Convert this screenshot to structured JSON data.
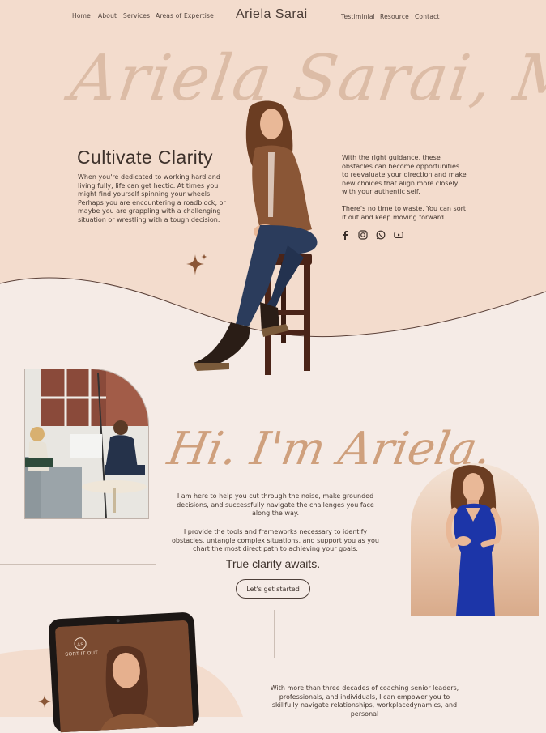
{
  "nav": {
    "left": [
      "Home",
      "About",
      "Services",
      "Areas of Expertise"
    ],
    "brand": "Ariela Sarai",
    "right": [
      "Testiminial",
      "Resource",
      "Contact"
    ]
  },
  "hero": {
    "script_name": "Ariela Sarai, MSW",
    "heading": "Cultivate Clarity",
    "left_text": "When you're dedicated to working hard and living fully, life can get hectic. At times you might find yourself spinning your wheels. Perhaps you are encountering a roadblock, or maybe you are grappling with a challenging situation or wrestling with a tough decision.",
    "right_text_1": "With the right guidance, these obstacles can become opportunities to reevaluate your direction and make new choices that align more closely with your authentic self.",
    "right_text_2": "There's no time to waste. You can sort it out and keep moving forward.",
    "socials": [
      "facebook-icon",
      "instagram-icon",
      "whatsapp-icon",
      "youtube-icon"
    ]
  },
  "about": {
    "script_heading": "Hi. I'm Ariela.",
    "text_1": "I am here to help you cut through the noise, make grounded decisions, and successfully navigate the challenges you face along the way.",
    "text_2": "I provide the tools and frameworks necessary to identify obstacles, untangle complex situations, and support you as you chart the most direct path to achieving your goals.",
    "tagline": "True clarity awaits.",
    "cta": "Let's get started"
  },
  "tablet": {
    "logo_text": "SORT IT OUT"
  },
  "bottom": {
    "text": "With more than three decades of coaching senior leaders, professionals, and individuals, I can empower you to skillfully navigate relationships, workplacedynamics, and personal"
  },
  "colors": {
    "hero_bg": "#f3dccd",
    "page_bg": "#f5ebe6",
    "accent_script": "#d9b7a0",
    "sparkle": "#8a5636"
  }
}
